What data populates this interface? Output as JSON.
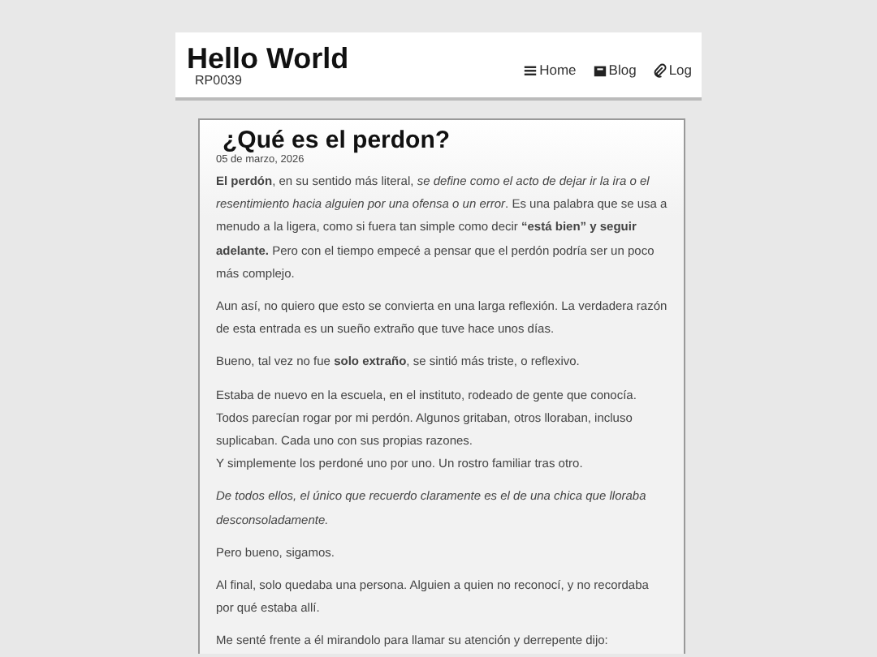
{
  "header": {
    "title": "Hello World",
    "subtitle": "RP0039",
    "nav": [
      {
        "label": "Home"
      },
      {
        "label": "Blog"
      },
      {
        "label": "Log"
      }
    ]
  },
  "post": {
    "title": "¿Qué es el perdon?",
    "date": "05 de marzo, 2026",
    "paragraphs": [
      {
        "text": "**El perdón**, en su sentido más literal, *se define como el acto de dejar ir la ira o el resentimiento hacia alguien por una ofensa o un error*. Es una palabra que se usa a menudo a la ligera, como si fuera tan simple como decir **“está bien” y seguir adelante.** Pero con el tiempo empecé a pensar que el perdón podría ser un poco más complejo.",
        "italic": false
      },
      {
        "text": "Aun así, no quiero que esto se convierta en una larga reflexión. La verdadera razón de esta entrada es un sueño extraño que tuve hace unos días.",
        "italic": false
      },
      {
        "text": "Bueno, tal vez no fue **solo extraño**, se sintió más triste, o reflexivo.",
        "italic": false
      },
      {
        "text": "Estaba de nuevo en la escuela, en el instituto, rodeado de gente que conocía. Todos parecían rogar por mi perdón. Algunos gritaban, otros lloraban, incluso suplicaban. Cada uno con sus propias razones.\nY simplemente los perdoné uno por uno. Un rostro familiar tras otro.",
        "italic": false
      },
      {
        "text": "De todos ellos, el único que recuerdo claramente es el de una chica que lloraba desconsoladamente.",
        "italic": true
      },
      {
        "text": "Pero bueno, sigamos.",
        "italic": false
      },
      {
        "text": "Al final, solo quedaba una persona. Alguien a quien no reconocí, y no recordaba por qué estaba allí.",
        "italic": false
      },
      {
        "text": "Me senté frente a él mirandolo para llamar su atención y derrepente dijo:",
        "italic": false
      }
    ]
  }
}
